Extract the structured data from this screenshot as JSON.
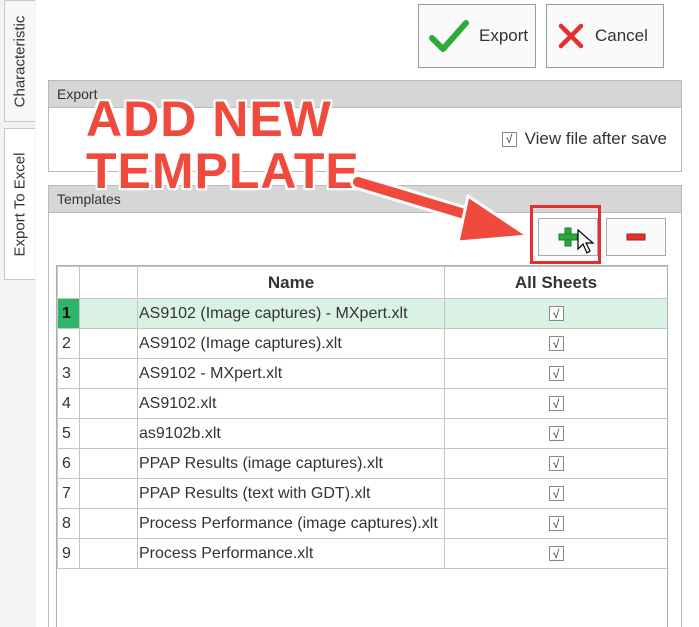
{
  "side_tabs": [
    "Characteristic",
    "Export To Excel"
  ],
  "toolbar": {
    "export_label": "Export",
    "cancel_label": "Cancel"
  },
  "export_group": {
    "title": "Export",
    "view_file_label": "View file after save",
    "view_file_checked": true
  },
  "templates_group": {
    "title": "Templates"
  },
  "annotation": {
    "line1": "ADD NEW",
    "line2": "TEMPLATE"
  },
  "grid": {
    "columns": [
      "",
      "",
      "Name",
      "All Sheets"
    ],
    "rows": [
      {
        "num": "1",
        "name": "AS9102 (Image captures) - MXpert.xlt",
        "all_sheets": "√"
      },
      {
        "num": "2",
        "name": "AS9102 (Image captures).xlt",
        "all_sheets": "√"
      },
      {
        "num": "3",
        "name": "AS9102 - MXpert.xlt",
        "all_sheets": "√"
      },
      {
        "num": "4",
        "name": "AS9102.xlt",
        "all_sheets": "√"
      },
      {
        "num": "5",
        "name": "as9102b.xlt",
        "all_sheets": "√"
      },
      {
        "num": "6",
        "name": "PPAP Results (image captures).xlt",
        "all_sheets": "√"
      },
      {
        "num": "7",
        "name": "PPAP Results (text with GDT).xlt",
        "all_sheets": "√"
      },
      {
        "num": "8",
        "name": "Process Performance (image captures).xlt",
        "all_sheets": "√"
      },
      {
        "num": "9",
        "name": "Process Performance.xlt",
        "all_sheets": "√"
      }
    ],
    "selected_row": 1
  },
  "colors": {
    "selected_row": "#d9f2e4",
    "selected_index": "#2fb56a",
    "annotation": "#ef4a3d",
    "check_icon": "#2eaa3a",
    "cancel_icon": "#e0322f"
  },
  "icons": [
    "checkmark-icon",
    "x-icon",
    "plus-icon",
    "minus-icon",
    "cursor-icon"
  ]
}
